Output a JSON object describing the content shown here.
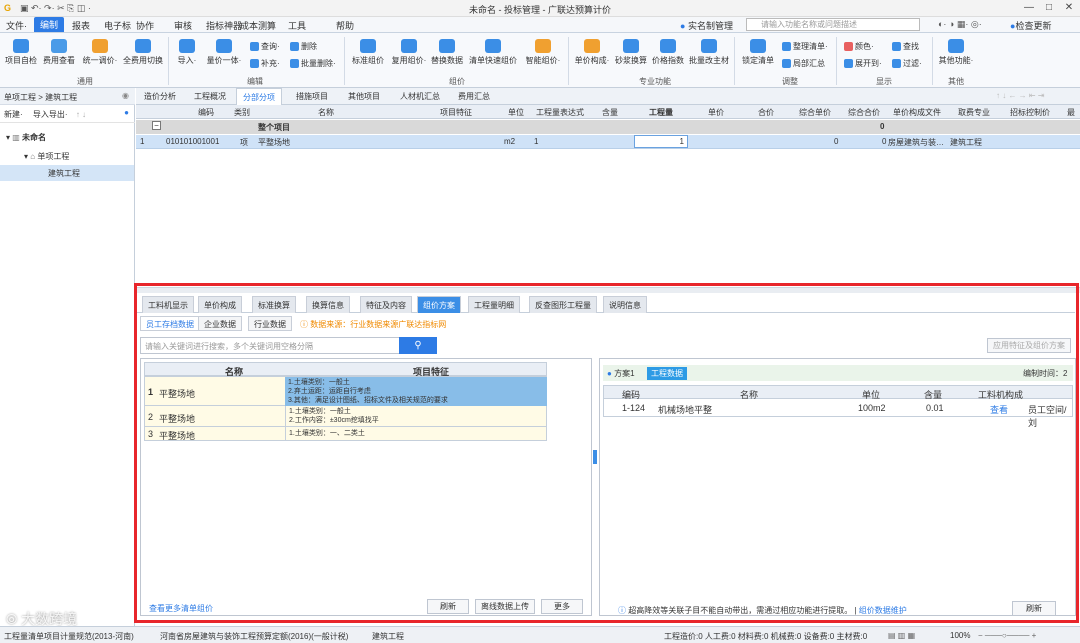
{
  "window": {
    "title": "未命名 - 投标管理 - 广联达预算计价",
    "right_actions": [
      "实名制管理",
      "检查更新"
    ]
  },
  "menu": {
    "items": [
      "文件·",
      "编制",
      "报表",
      "电子标",
      "协作",
      "审核",
      "指标神器",
      "成本测算",
      "工具",
      "帮助"
    ],
    "active": "编制",
    "search_placeholder": "请输入功能名称或问题描述"
  },
  "ribbon": {
    "general": {
      "label": "通用",
      "buttons": [
        "项目自检",
        "费用查看",
        "统一调价·",
        "全费用切换"
      ]
    },
    "edit": {
      "label": "编辑",
      "buttons": [
        "导入·",
        "量价一体·"
      ],
      "small": [
        "查询·",
        "删除",
        "补充·",
        "批量删除·"
      ]
    },
    "pricing": {
      "label": "组价",
      "buttons": [
        "标准组价",
        "复用组价·",
        "替换数据",
        "清单快速组价",
        "智能组价·"
      ]
    },
    "pro": {
      "label": "专业功能",
      "buttons": [
        "单价构成·",
        "砂浆换算",
        "价格指数",
        "批量改主材"
      ]
    },
    "adjust": {
      "label": "调整",
      "buttons": [
        "锁定清单"
      ],
      "small": [
        "整理清单·",
        "局部汇总"
      ]
    },
    "display": {
      "label": "显示",
      "small": [
        "颜色·",
        "查找",
        "展开到·",
        "过滤·"
      ]
    },
    "other": {
      "label": "其他",
      "buttons": [
        "其他功能·"
      ]
    }
  },
  "left_panel": {
    "breadcrumb": "单项工程 > 建筑工程",
    "toolbar": [
      "新建·",
      "导入导出·"
    ],
    "tree": [
      {
        "label": "未命名",
        "level": 0
      },
      {
        "label": "单项工程",
        "level": 1
      },
      {
        "label": "建筑工程",
        "level": 2
      }
    ]
  },
  "main_tabs": {
    "items": [
      "造价分析",
      "工程概况",
      "分部分项",
      "措施项目",
      "其他项目",
      "人材机汇总",
      "费用汇总"
    ],
    "active": "分部分项"
  },
  "grid": {
    "columns": [
      "编码",
      "类别",
      "名称",
      "项目特征",
      "单位",
      "工程量表达式",
      "含量",
      "工程量",
      "单价",
      "合价",
      "综合单价",
      "综合合价",
      "单价构成文件",
      "取费专业",
      "招标控制价",
      "最"
    ],
    "summary_row": {
      "name": "整个项目",
      "total": "0"
    },
    "rows": [
      {
        "index": "1",
        "code": "010101001001",
        "type": "项",
        "name": "平整场地",
        "unit": "m2",
        "expr": "1",
        "qty": "1",
        "composite_total": "0",
        "composite_total2": "0",
        "price_file": "房屋建筑与装…",
        "discipline": "建筑工程"
      }
    ]
  },
  "bottom": {
    "tabs": [
      "工料机显示",
      "单价构成",
      "标准换算",
      "换算信息",
      "特征及内容",
      "组价方案",
      "工程量明细",
      "反查图形工程量",
      "说明信息"
    ],
    "active_tab": "组价方案",
    "subtabs": [
      "员工存档数据",
      "企业数据",
      "行业数据"
    ],
    "source_note": "数据来源：行业数据来源广联达指标网",
    "search_placeholder": "请输入关键词进行搜索，多个关键词用空格分隔",
    "apply_button": "应用特征及组价方案",
    "list_headers": [
      "名称",
      "项目特征"
    ],
    "list": [
      {
        "index": "1",
        "name": "平整场地",
        "features": [
          "1.土壤类别：一般土",
          "2.弃土运距：运距自行考虑",
          "3.其他：满足设计图纸、招标文件及相关规范的要求"
        ]
      },
      {
        "index": "2",
        "name": "平整场地",
        "features": [
          "1.土壤类别：一般土",
          "2.工作内容：±30cm挖填找平"
        ]
      },
      {
        "index": "3",
        "name": "平整场地",
        "features": [
          "1.土壤类别：一、二类土"
        ]
      }
    ],
    "more_link": "查看更多清单组价",
    "left_buttons": [
      "刷新",
      "离线数据上传",
      "更多"
    ],
    "plan": {
      "label": "方案1",
      "badge": "工程数据",
      "compile_time": "编制时间：2",
      "headers": [
        "编码",
        "名称",
        "单位",
        "含量",
        "工料机构成"
      ],
      "row": {
        "code": "1-124",
        "name": "机械场地平整",
        "unit": "100m2",
        "content": "0.01",
        "action": "查看",
        "extra": "员工空间/刘"
      }
    },
    "footer_note": "超高降效等关联子目不能自动带出，需通过相应功能进行提取。",
    "footer_link": "组价数据维护",
    "right_button": "刷新"
  },
  "status": {
    "items": [
      "工程量清单项目计量规范(2013-河南)",
      "河南省房屋建筑与装饰工程预算定额(2016)(一般计税)",
      "建筑工程"
    ],
    "costs": "工程造价:0  人工费:0  材料费:0  机械费:0  设备费:0  主材费:0",
    "zoom": "100%"
  },
  "watermark": "大数跨境"
}
